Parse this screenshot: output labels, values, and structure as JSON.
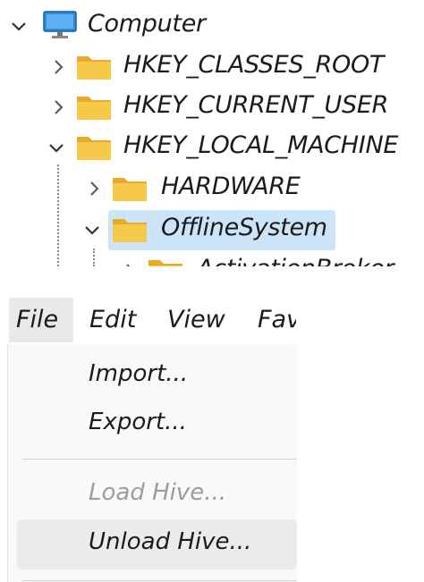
{
  "tree": {
    "root": {
      "label": "Computer",
      "expanded": true,
      "icon": "monitor-icon"
    },
    "items": [
      {
        "label": "HKEY_CLASSES_ROOT",
        "expanded": false
      },
      {
        "label": "HKEY_CURRENT_USER",
        "expanded": false
      },
      {
        "label": "HKEY_LOCAL_MACHINE",
        "expanded": true
      },
      {
        "label": "HARDWARE",
        "expanded": false
      },
      {
        "label": "OfflineSystem",
        "expanded": true,
        "selected": true
      },
      {
        "label": "ActivationBroker",
        "expanded": false
      }
    ],
    "selection_color": "#cce4f7",
    "folder_color": "#f7c948"
  },
  "menubar": {
    "items": [
      "File",
      "Edit",
      "View",
      "Fav"
    ]
  },
  "file_menu": {
    "import": "Import...",
    "export": "Export...",
    "load_hive": "Load Hive...",
    "unload_hive": "Unload Hive..."
  }
}
